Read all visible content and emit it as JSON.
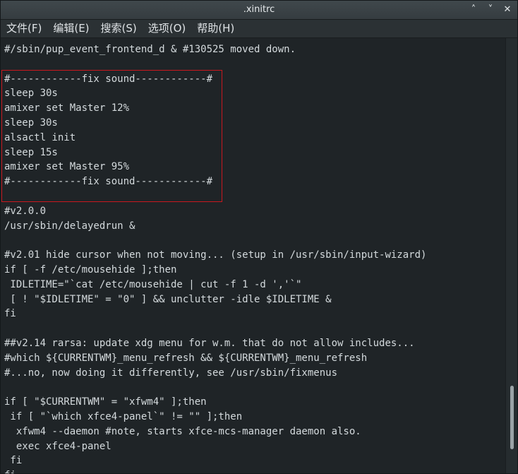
{
  "window": {
    "title": ".xinitrc",
    "minimize_icon": "˄",
    "maximize_icon": "˅",
    "close_icon": "✕"
  },
  "menu": [
    {
      "label": "文件(F)"
    },
    {
      "label": "编辑(E)"
    },
    {
      "label": "搜索(S)"
    },
    {
      "label": "选项(O)"
    },
    {
      "label": "帮助(H)"
    }
  ],
  "editor": {
    "lines": [
      "#/sbin/pup_event_frontend_d & #130525 moved down.",
      "",
      "#------------fix sound------------#",
      "sleep 30s",
      "amixer set Master 12%",
      "sleep 30s",
      "alsactl init",
      "sleep 15s",
      "amixer set Master 95%",
      "#------------fix sound------------#",
      "",
      "#v2.0.0",
      "/usr/sbin/delayedrun &",
      "",
      "#v2.01 hide cursor when not moving... (setup in /usr/sbin/input-wizard)",
      "if [ -f /etc/mousehide ];then",
      " IDLETIME=\"`cat /etc/mousehide | cut -f 1 -d ','`\"",
      " [ ! \"$IDLETIME\" = \"0\" ] && unclutter -idle $IDLETIME &",
      "fi",
      "",
      "##v2.14 rarsa: update xdg menu for w.m. that do not allow includes...",
      "#which ${CURRENTWM}_menu_refresh && ${CURRENTWM}_menu_refresh",
      "#...no, now doing it differently, see /usr/sbin/fixmenus",
      "",
      "if [ \"$CURRENTWM\" = \"xfwm4\" ];then",
      " if [ \"`which xfce4-panel`\" != \"\" ];then",
      "  xfwm4 --daemon #note, starts xfce-mcs-manager daemon also.",
      "  exec xfce4-panel",
      " fi",
      "fi"
    ]
  },
  "colors": {
    "background": "#1f2427",
    "text": "#d4dadd",
    "highlight_border": "#c8181e"
  }
}
